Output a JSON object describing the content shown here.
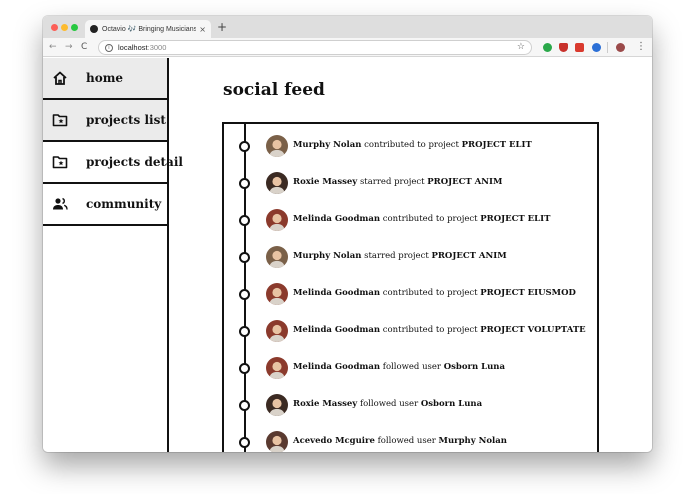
{
  "browser": {
    "tab_title": "Octavio 🎶 Bringing Musicians Together",
    "tab_close": "×",
    "new_tab": "+",
    "url_host": "localhost",
    "url_port": ":3000",
    "nav_back": "←",
    "nav_forward": "→",
    "nav_reload": "C",
    "bookmark_star": "☆",
    "menu": "⋮"
  },
  "sidebar": {
    "items": [
      {
        "label": "home",
        "icon": "home-icon",
        "active": true
      },
      {
        "label": "projects list",
        "icon": "folder-star-icon",
        "active": true
      },
      {
        "label": "projects detail",
        "icon": "folder-star-icon",
        "active": false
      },
      {
        "label": "community",
        "icon": "people-icon",
        "active": false
      }
    ]
  },
  "feed": {
    "title": "social feed",
    "entries": [
      {
        "user": "Murphy Nolan",
        "action": "contributed to project",
        "target": "PROJECT ELIT",
        "avatar_color": "#7a6048"
      },
      {
        "user": "Roxie Massey",
        "action": "starred project",
        "target": "PROJECT ANIM",
        "avatar_color": "#3b2a22"
      },
      {
        "user": "Melinda Goodman",
        "action": "contributed to project",
        "target": "PROJECT ELIT",
        "avatar_color": "#8b3a2c"
      },
      {
        "user": "Murphy Nolan",
        "action": "starred project",
        "target": "PROJECT ANIM",
        "avatar_color": "#7a6048"
      },
      {
        "user": "Melinda Goodman",
        "action": "contributed to project",
        "target": "PROJECT EIUSMOD",
        "avatar_color": "#8b3a2c"
      },
      {
        "user": "Melinda Goodman",
        "action": "contributed to project",
        "target": "PROJECT VOLUPTATE",
        "avatar_color": "#8b3a2c"
      },
      {
        "user": "Melinda Goodman",
        "action": "followed user",
        "target": "Osborn Luna",
        "avatar_color": "#8b3a2c"
      },
      {
        "user": "Roxie Massey",
        "action": "followed user",
        "target": "Osborn Luna",
        "avatar_color": "#3b2a22"
      },
      {
        "user": "Acevedo Mcguire",
        "action": "followed user",
        "target": "Murphy Nolan",
        "avatar_color": "#5a3a30"
      }
    ]
  }
}
